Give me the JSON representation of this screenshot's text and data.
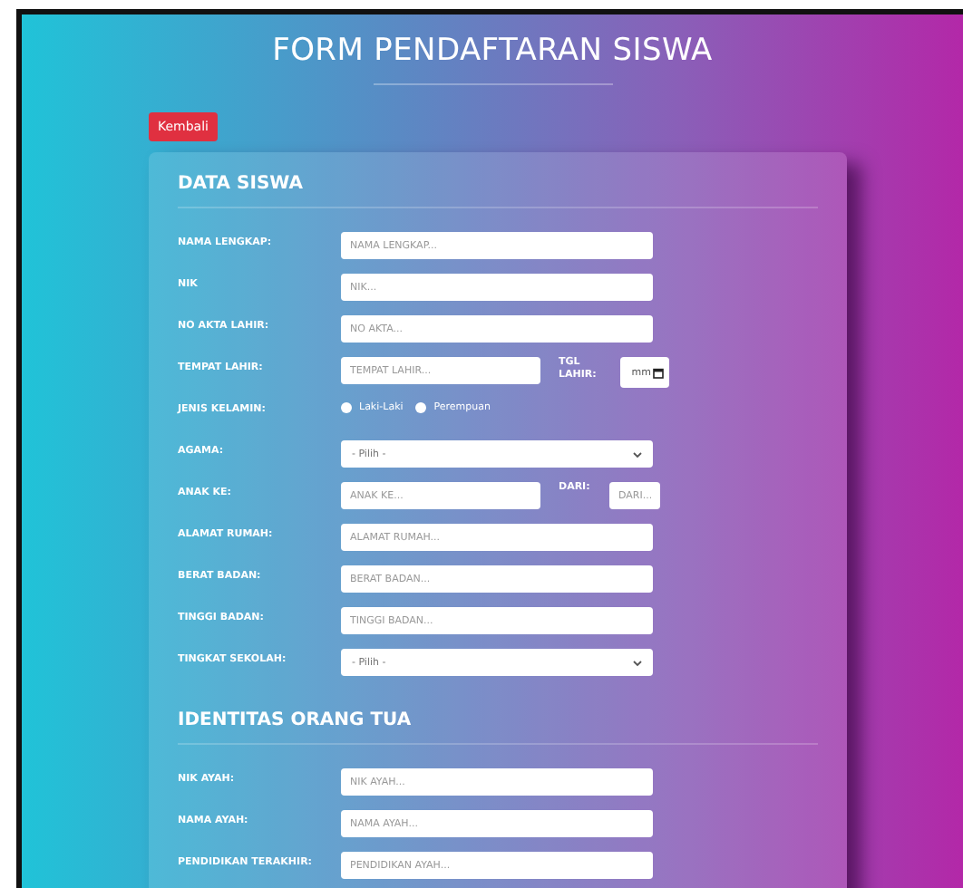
{
  "title": "FORM PENDAFTARAN SISWA",
  "back_button": "Kembali",
  "sections": [
    {
      "heading": "DATA SISWA",
      "fields": [
        {
          "kind": "text",
          "label": "NAMA LENGKAP:",
          "placeholder": "NAMA LENGKAP..."
        },
        {
          "kind": "text",
          "label": "NIK",
          "placeholder": "NIK..."
        },
        {
          "kind": "text",
          "label": "NO AKTA LAHIR:",
          "placeholder": "NO AKTA..."
        },
        {
          "kind": "date_pair",
          "label": "TEMPAT LAHIR:",
          "placeholder": "TEMPAT LAHIR...",
          "second_label": "TGL LAHIR:",
          "date_value": "mm"
        },
        {
          "kind": "radio",
          "label": "JENIS KELAMIN:",
          "options": [
            {
              "label": "Laki-Laki",
              "selected": false
            },
            {
              "label": "Perempuan",
              "selected": false
            }
          ]
        },
        {
          "kind": "select",
          "label": "AGAMA:",
          "value": "- Pilih -"
        },
        {
          "kind": "text_pair",
          "label": "ANAK KE:",
          "placeholder": "ANAK KE...",
          "second_label": "DARI:",
          "second_placeholder": "DARI..."
        },
        {
          "kind": "text",
          "label": "ALAMAT RUMAH:",
          "placeholder": "ALAMAT RUMAH..."
        },
        {
          "kind": "text",
          "label": "BERAT BADAN:",
          "placeholder": "BERAT BADAN..."
        },
        {
          "kind": "text",
          "label": "TINGGI BADAN:",
          "placeholder": "TINGGI BADAN..."
        },
        {
          "kind": "select",
          "label": "TINGKAT SEKOLAH:",
          "value": "- Pilih -"
        }
      ]
    },
    {
      "heading": "IDENTITAS ORANG TUA",
      "fields": [
        {
          "kind": "text",
          "label": "NIK AYAH:",
          "placeholder": "NIK AYAH..."
        },
        {
          "kind": "text",
          "label": "NAMA AYAH:",
          "placeholder": "NAMA AYAH..."
        },
        {
          "kind": "text",
          "label": "PENDIDIKAN TERAKHIR:",
          "placeholder": "PENDIDIKAN AYAH..."
        }
      ]
    }
  ]
}
